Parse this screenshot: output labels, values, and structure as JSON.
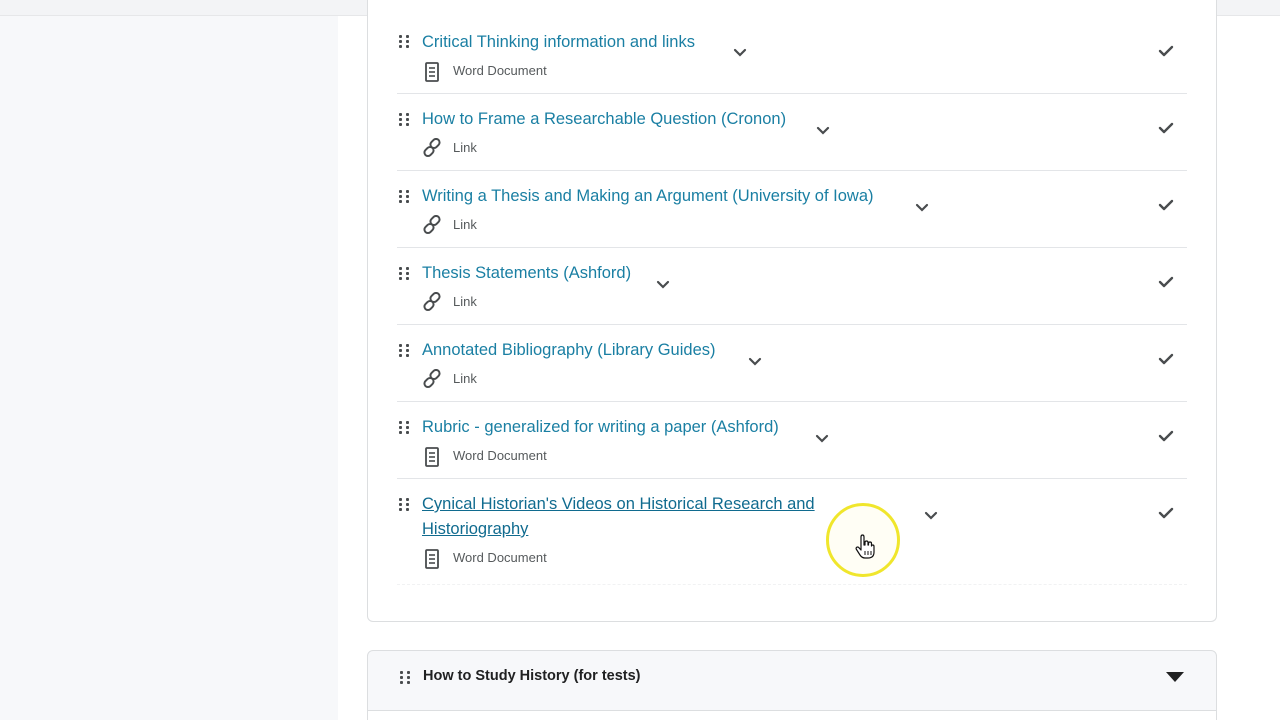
{
  "module_topics": [
    {
      "title": "Critical Thinking information and links",
      "type": "Word Document",
      "icon": "document-icon",
      "completed": true
    },
    {
      "title": "How to Frame a Researchable Question (Cronon)",
      "type": "Link",
      "icon": "link-icon",
      "completed": true
    },
    {
      "title": "Writing a Thesis and Making an Argument (University of Iowa)",
      "type": "Link",
      "icon": "link-icon",
      "completed": true
    },
    {
      "title": "Thesis Statements (Ashford)",
      "type": "Link",
      "icon": "link-icon",
      "completed": true
    },
    {
      "title": "Annotated Bibliography (Library Guides)",
      "type": "Link",
      "icon": "link-icon",
      "completed": true
    },
    {
      "title": "Rubric - generalized for writing a paper (Ashford)",
      "type": "Word Document",
      "icon": "document-icon",
      "completed": true
    },
    {
      "title": "Cynical Historian's Videos on Historical Research and Historiography",
      "type": "Word Document",
      "icon": "document-icon",
      "completed": true
    }
  ],
  "next_module": {
    "title": "How to Study History (for tests)",
    "collapsed_icon": "caret-down-icon"
  },
  "colors": {
    "link": "#1a7fa3",
    "text": "#494c4e",
    "border": "#dcdee0",
    "cursor_highlight": "#f0e62c"
  }
}
